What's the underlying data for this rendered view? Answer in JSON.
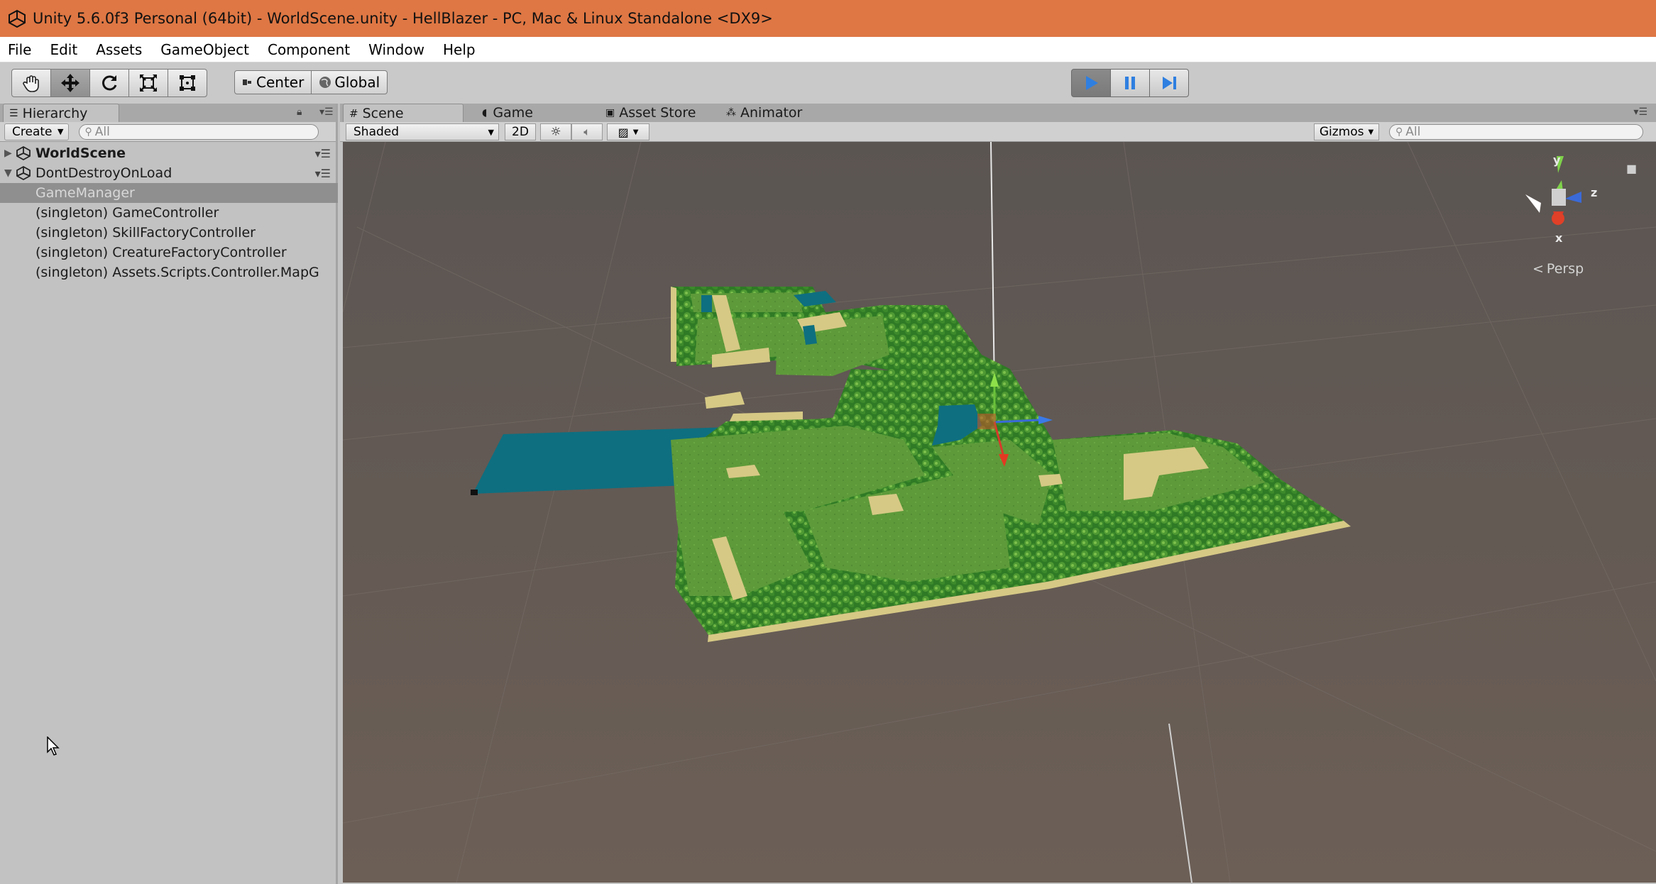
{
  "window": {
    "title": "Unity 5.6.0f3 Personal (64bit) - WorldScene.unity - HellBlazer - PC, Mac & Linux Standalone <DX9>",
    "title_bar_color": "#de7744"
  },
  "menu": {
    "items": [
      "File",
      "Edit",
      "Assets",
      "GameObject",
      "Component",
      "Window",
      "Help"
    ]
  },
  "toolbar": {
    "transform_tools": [
      "hand-icon",
      "move-icon",
      "rotate-icon",
      "scale-icon",
      "rect-icon"
    ],
    "pivot_label": "Center",
    "space_label": "Global",
    "play_controls": [
      "play-icon",
      "pause-icon",
      "step-icon"
    ],
    "play_active_color": "#2f7fe0"
  },
  "hierarchy": {
    "tab_label": "Hierarchy",
    "create_label": "Create",
    "search_placeholder": "All",
    "rows": [
      {
        "label": "WorldScene",
        "bold": true,
        "expanded": false,
        "scene": true
      },
      {
        "label": "DontDestroyOnLoad",
        "bold": false,
        "expanded": true,
        "scene": true
      },
      {
        "label": "GameManager",
        "selected": true
      },
      {
        "label": "(singleton) GameController"
      },
      {
        "label": "(singleton) SkillFactoryController"
      },
      {
        "label": "(singleton) CreatureFactoryController"
      },
      {
        "label": "(singleton) Assets.Scripts.Controller.MapG"
      }
    ]
  },
  "scene_panel": {
    "tabs": [
      "Scene",
      "Game",
      "Asset Store",
      "Animator"
    ],
    "active_tab": "Scene",
    "shading_mode": "Shaded",
    "mode_2d_label": "2D",
    "gizmos_label": "Gizmos",
    "search_placeholder": "All",
    "projection_label": "Persp",
    "axes": {
      "x": "x",
      "y": "y",
      "z": "z"
    },
    "colors": {
      "grass": "#5e9a3a",
      "trees": "#2f7a25",
      "water": "#0e6f80",
      "sand": "#d6c985",
      "ground": "#6b615a"
    }
  }
}
